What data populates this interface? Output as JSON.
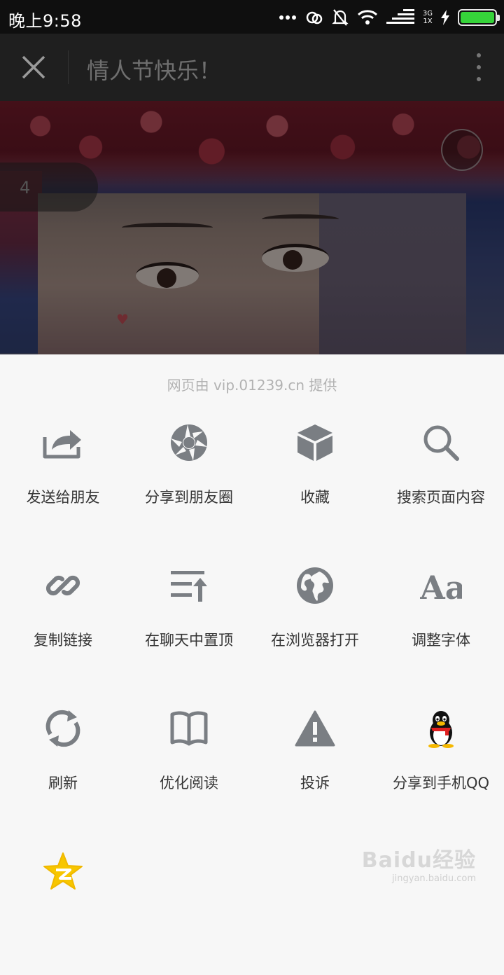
{
  "status_bar": {
    "time": "晚上9:58",
    "network_top": "3G",
    "network_bottom": "1X"
  },
  "header": {
    "title": "情人节快乐！"
  },
  "web_page": {
    "page_number": "4"
  },
  "share_sheet": {
    "provider_text": "网页由 vip.01239.cn 提供",
    "items": [
      {
        "label": "发送给朋友",
        "icon": "send-to-friend-icon"
      },
      {
        "label": "分享到朋友圈",
        "icon": "moments-icon"
      },
      {
        "label": "收藏",
        "icon": "favorite-box-icon"
      },
      {
        "label": "搜索页面内容",
        "icon": "search-icon"
      },
      {
        "label": "复制链接",
        "icon": "link-icon"
      },
      {
        "label": "在聊天中置顶",
        "icon": "pin-to-top-icon"
      },
      {
        "label": "在浏览器打开",
        "icon": "globe-icon"
      },
      {
        "label": "调整字体",
        "icon": "font-icon"
      },
      {
        "label": "刷新",
        "icon": "refresh-icon"
      },
      {
        "label": "优化阅读",
        "icon": "book-icon"
      },
      {
        "label": "投诉",
        "icon": "warning-icon"
      },
      {
        "label": "分享到手机QQ",
        "icon": "qq-penguin-icon"
      },
      {
        "label": "",
        "icon": "qzone-star-icon"
      }
    ]
  },
  "watermark": {
    "main": "Baidu经验",
    "sub": "jingyan.baidu.com"
  },
  "colors": {
    "icon_gray": "#7a7e83",
    "sheet_bg": "#f7f7f7",
    "titlebar_bg": "#1f1f1f",
    "battery_green": "#36d43a"
  }
}
